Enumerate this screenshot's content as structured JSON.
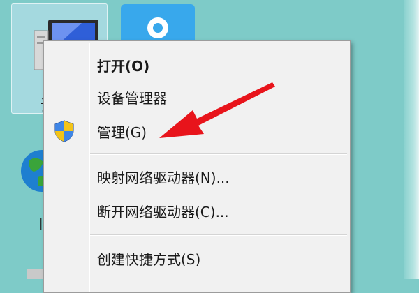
{
  "desktop": {
    "computer_label": "计",
    "second_label": "I"
  },
  "context_menu": {
    "items": [
      {
        "label": "打开(O)",
        "bold": true
      },
      {
        "label": "设备管理器"
      },
      {
        "label": "管理(G)",
        "icon": "uac-shield-icon"
      },
      {
        "label": "映射网络驱动器(N)..."
      },
      {
        "label": "断开网络驱动器(C)..."
      },
      {
        "label": "创建快捷方式(S)"
      }
    ]
  },
  "colors": {
    "desktop_background": "#7ecbc8",
    "menu_background": "#f1f1f1",
    "annotation_arrow": "#e8141b"
  }
}
